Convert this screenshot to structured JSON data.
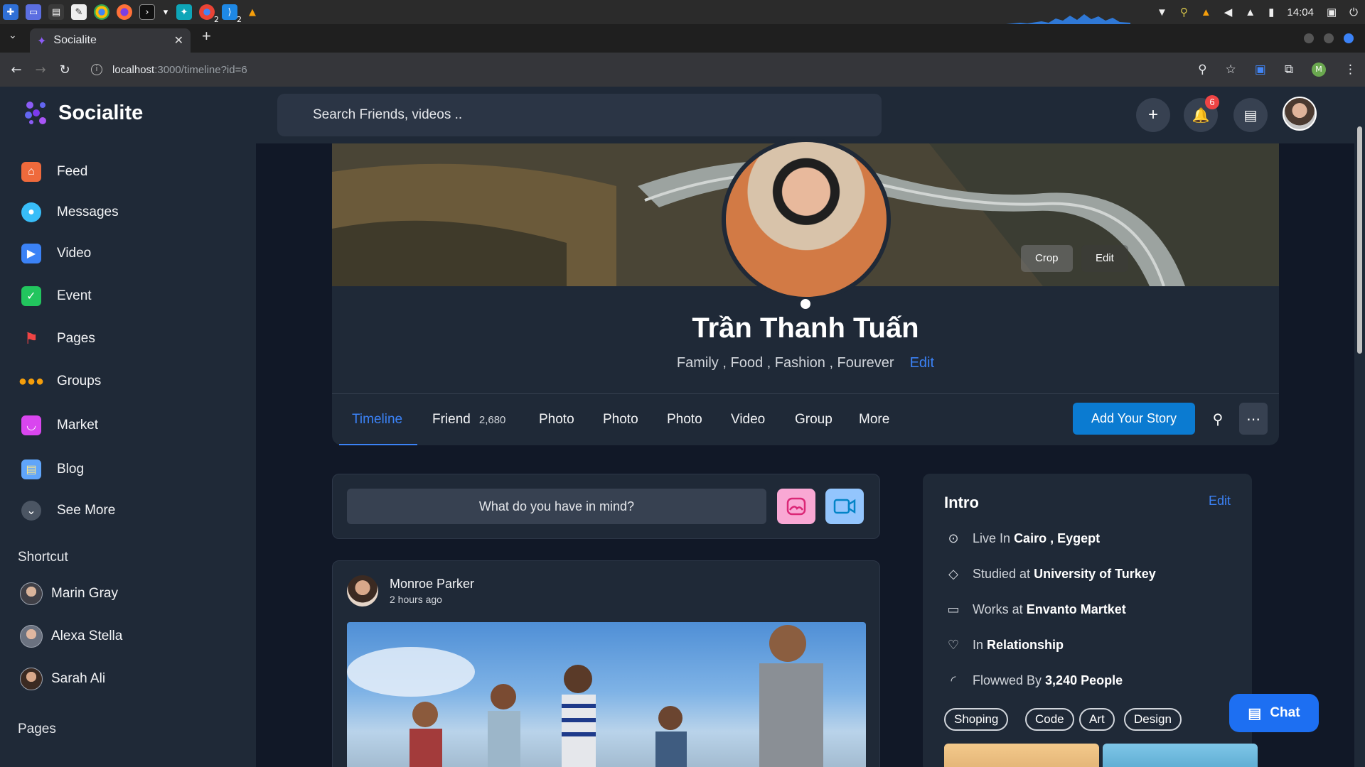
{
  "os": {
    "clock": "14:04",
    "badge_a": "2",
    "badge_b": "2"
  },
  "browser": {
    "tab_title": "Socialite",
    "url_host": "localhost",
    "url_path": ":3000/timeline?id=6",
    "profile_letter": "M"
  },
  "sidebar": {
    "logo": "Socialite",
    "items": [
      {
        "label": "Feed",
        "icon": "home-icon",
        "color": "#ef6a3c"
      },
      {
        "label": "Messages",
        "icon": "chat-bubbles-icon",
        "color": "#38bdf8"
      },
      {
        "label": "Video",
        "icon": "video-clapper-icon",
        "color": "#3b82f6"
      },
      {
        "label": "Event",
        "icon": "calendar-icon",
        "color": "#22c55e"
      },
      {
        "label": "Pages",
        "icon": "flag-icon",
        "color": "#ef4444"
      },
      {
        "label": "Groups",
        "icon": "group-icon",
        "color": "#f59e0b"
      },
      {
        "label": "Market",
        "icon": "shopping-bag-icon",
        "color": "#d946ef"
      },
      {
        "label": "Blog",
        "icon": "blog-icon",
        "color": "#60a5fa"
      },
      {
        "label": "See More",
        "icon": "chevron-down-icon",
        "color": "#4b5563"
      }
    ],
    "shortcut_heading": "Shortcut",
    "shortcuts": [
      "Marin Gray",
      "Alexa Stella",
      "Sarah Ali"
    ],
    "pages_heading": "Pages"
  },
  "topbar": {
    "search_placeholder": "Search Friends, videos ..",
    "notif_count": "6"
  },
  "profile": {
    "crop_label": "Crop",
    "edit_cover_label": "Edit",
    "name": "Trần Thanh Tuấn",
    "bio": "Family , Food , Fashion , Fourever",
    "bio_edit": "Edit",
    "tabs": [
      "Timeline",
      "Friend",
      "Photo",
      "Photo",
      "Photo",
      "Video",
      "Group",
      "More"
    ],
    "friend_count": "2,680",
    "add_story": "Add Your Story"
  },
  "composer": {
    "placeholder": "What do you have in mind?"
  },
  "post": {
    "author": "Monroe Parker",
    "time": "2 hours ago"
  },
  "intro": {
    "title": "Intro",
    "edit": "Edit",
    "live_prefix": "Live In",
    "live_value": "Cairo , Eygept",
    "study_prefix": "Studied at",
    "study_value": "University of Turkey",
    "work_prefix": "Works at",
    "work_value": "Envanto Martket",
    "rel_prefix": "In",
    "rel_value": "Relationship",
    "follow_prefix": "Flowwed By",
    "follow_value": "3,240 People",
    "tags": [
      "Shoping",
      "Code",
      "Art",
      "Design"
    ]
  },
  "chat": {
    "label": "Chat"
  },
  "colors": {
    "accent": "#3b82f6",
    "primary_button": "#0b7bd1",
    "chat_button": "#1d6ff2",
    "badge": "#ef4444"
  }
}
